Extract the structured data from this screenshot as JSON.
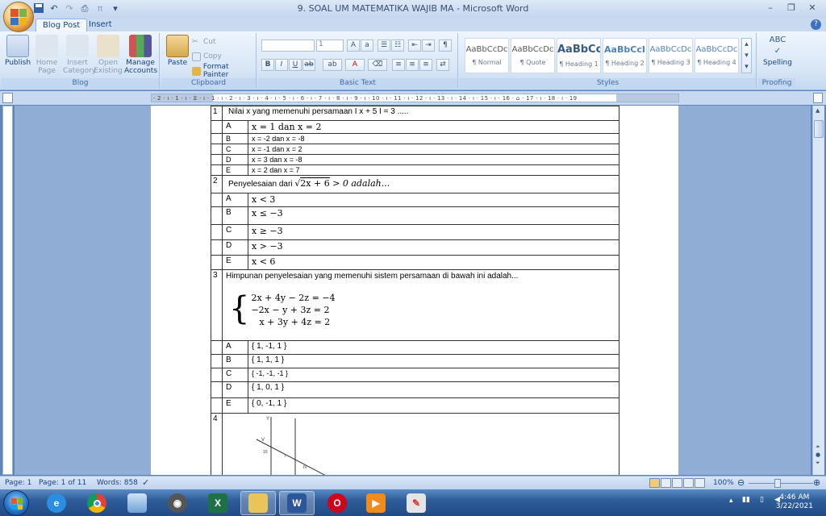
{
  "window": {
    "title": "9. SOAL UM MATEMATIKA WAJIB MA - Microsoft Word",
    "controls": [
      "–",
      "❐",
      "✕"
    ]
  },
  "tabs": [
    {
      "label": "Blog Post",
      "active": true
    },
    {
      "label": "Insert",
      "active": false
    }
  ],
  "ribbon": {
    "blog": {
      "label": "Blog",
      "buttons": [
        {
          "label": "Publish",
          "enabled": true
        },
        {
          "label": "Home Page",
          "enabled": false
        },
        {
          "label": "Insert Category",
          "enabled": false
        },
        {
          "label": "Open Existing",
          "enabled": false
        },
        {
          "label": "Manage Accounts",
          "enabled": true
        }
      ]
    },
    "clipboard": {
      "label": "Clipboard",
      "paste": "Paste",
      "cut": "Cut",
      "copy": "Copy",
      "format_painter": "Format Painter"
    },
    "basic_text": {
      "label": "Basic Text",
      "font_size": "1"
    },
    "styles": {
      "label": "Styles",
      "items": [
        {
          "sample": "AaBbCcDc",
          "name": "¶ Normal"
        },
        {
          "sample": "AaBbCcDc",
          "name": "¶ Quote"
        },
        {
          "sample": "AaBbCc",
          "name": "¶ Heading 1"
        },
        {
          "sample": "AaBbCcI",
          "name": "¶ Heading 2"
        },
        {
          "sample": "AaBbCcDc",
          "name": "¶ Heading 3"
        },
        {
          "sample": "AaBbCcDc",
          "name": "¶ Heading 4"
        }
      ]
    },
    "proofing": {
      "label": "Proofing",
      "spelling": "Spelling"
    }
  },
  "ruler_text": "· 2 · ı · 1 · ı · ⧖ · ı · 1 · ı · 2 · ı · 3 · ı · 4 · ı · 5 · ı · 6 · ı · 7 · ı · 8 · ı · 9 · ı · 10 · ı · 11 · ı · 12 · ı · 13 · ı · 14 · ı · 15 · ı · 16 · ⌂ · 17 · ı · 18 · ı · 19",
  "questions": {
    "q1": {
      "num": "1",
      "text": "Nilai x yang memenuhi persamaan I x + 5 I = 3 .....",
      "options": [
        {
          "letter": "A",
          "text": "x = 1 dan x = 2"
        },
        {
          "letter": "B",
          "text": "x = -2 dan x = -8"
        },
        {
          "letter": "C",
          "text": "x = -1 dan x = 2"
        },
        {
          "letter": "D",
          "text": "x = 3 dan x = -8"
        },
        {
          "letter": "E",
          "text": "x = 2 dan x = 7"
        }
      ]
    },
    "q2": {
      "num": "2",
      "text_before": "Penyelesaian dari ",
      "radicand": "2x + 6",
      "text_after": "  > 0 adalah...",
      "options": [
        {
          "letter": "A",
          "text": "x < 3"
        },
        {
          "letter": "B",
          "text": "x ≤ −3"
        },
        {
          "letter": "C",
          "text": "x ≥ −3"
        },
        {
          "letter": "D",
          "text": "x > −3"
        },
        {
          "letter": "E",
          "text": "x < 6"
        }
      ]
    },
    "q3": {
      "num": "3",
      "text": "Himpunan penyelesaian yang memenuhi sistem persamaan di bawah ini adalah...",
      "equations": [
        "2x + 4y − 2z =  −4",
        "−2x − y + 3z = 2",
        "x + 3y + 4z = 2"
      ],
      "options": [
        {
          "letter": "A",
          "text": "{ 1, -1, 1 }"
        },
        {
          "letter": "B",
          "text": "{ 1, 1, 1 }"
        },
        {
          "letter": "C",
          "text": "{ -1, -1, -1 }"
        },
        {
          "letter": "D",
          "text": "{ 1, 0, 1 }"
        },
        {
          "letter": "E",
          "text": "{ 0, -1, 1 }"
        }
      ]
    },
    "q4": {
      "num": "4",
      "graph_labels": {
        "y": "Y",
        "v": "V",
        "ten": "10",
        "i": "I",
        "iv": "IV"
      }
    }
  },
  "status": {
    "page": "Page: 1",
    "page_of": "Page: 1 of 11",
    "words": "Words: 858",
    "zoom": "100%"
  },
  "taskbar": {
    "time": "4:46 AM",
    "date": "3/22/2021"
  },
  "colors": {
    "ribbon_text": "#15428b",
    "doc_background": "#90aed5",
    "taskbar": "#2f5d9a"
  }
}
